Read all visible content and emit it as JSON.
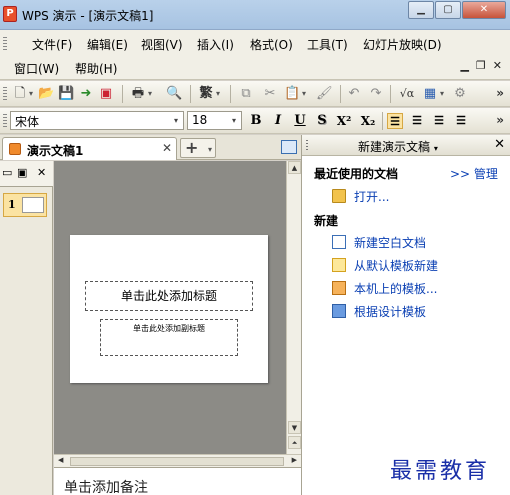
{
  "window": {
    "app_icon": "wps-presentation-icon",
    "title": "WPS 演示 - [演示文稿1]",
    "minimize": "minimize-icon",
    "maximize": "maximize-icon",
    "close": "close-icon"
  },
  "menu": {
    "row1": [
      "文件(F)",
      "编辑(E)",
      "视图(V)",
      "插入(I)",
      "格式(O)",
      "工具(T)",
      "幻灯片放映(D)"
    ],
    "row2": [
      "窗口(W)",
      "帮助(H)"
    ]
  },
  "format_toolbar": {
    "font_name": "宋体",
    "font_size": "18",
    "bold": "B",
    "italic": "I",
    "underline": "U",
    "shadow": "S",
    "superscript": "X²",
    "subscript": "X₂"
  },
  "standard_toolbar": {
    "traditional_chinese": "繁",
    "formula": "√α"
  },
  "doc_tabs": {
    "active_tab": "演示文稿1"
  },
  "slide": {
    "title_placeholder": "单击此处添加标题",
    "subtitle_placeholder": "单击此处添加副标题"
  },
  "thumbnails": {
    "slide_number": "1"
  },
  "notes": {
    "placeholder": "单击添加备注"
  },
  "task_pane": {
    "title": "新建演示文稿",
    "recent_heading": "最近使用的文档",
    "manage_link": ">> 管理",
    "open_link": "打开...",
    "new_heading": "新建",
    "new_blank": "新建空白文档",
    "from_default_template": "从默认模板新建",
    "local_templates": "本机上的模板...",
    "from_design_template": "根据设计模板"
  },
  "watermark": "最需教育"
}
